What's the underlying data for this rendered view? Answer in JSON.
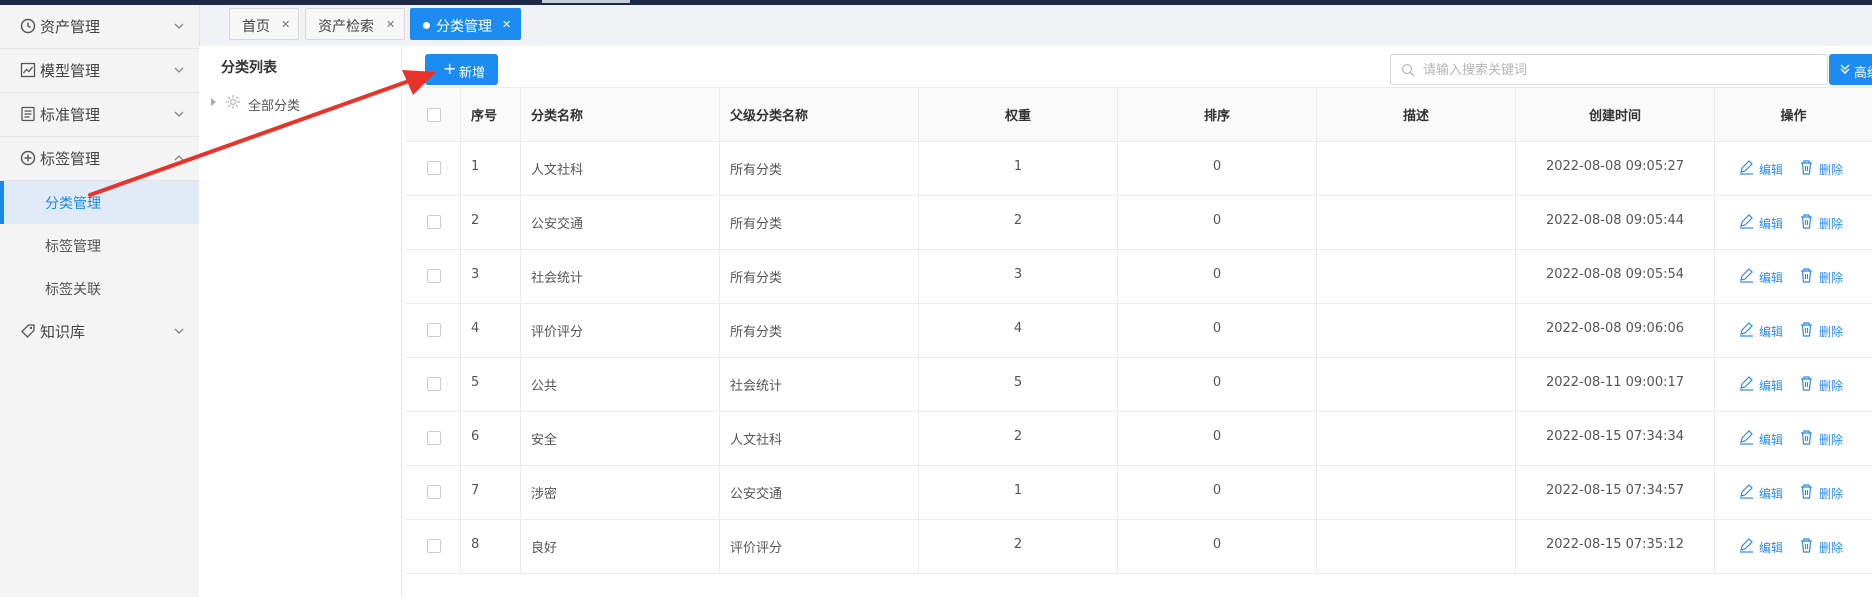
{
  "sidebar": {
    "groups": [
      {
        "label": "资产管理",
        "icon": "clock-icon"
      },
      {
        "label": "模型管理",
        "icon": "chart-icon"
      },
      {
        "label": "标准管理",
        "icon": "document-icon"
      },
      {
        "label": "标签管理",
        "icon": "plus-circle-icon"
      },
      {
        "label": "知识库",
        "icon": "tag-icon"
      }
    ],
    "sub_items": [
      {
        "label": "分类管理",
        "active": true
      },
      {
        "label": "标签管理",
        "active": false
      },
      {
        "label": "标签关联",
        "active": false
      }
    ]
  },
  "tabs": [
    {
      "label": "首页",
      "active": false
    },
    {
      "label": "资产检索",
      "active": false
    },
    {
      "label": "分类管理",
      "active": true
    }
  ],
  "tree": {
    "title": "分类列表",
    "root": "全部分类"
  },
  "toolbar": {
    "add_label": "新增",
    "search_placeholder": "请输入搜索关键词",
    "advanced_label": "高级"
  },
  "table": {
    "headers": [
      "序号",
      "分类名称",
      "父级分类名称",
      "权重",
      "排序",
      "描述",
      "创建时间",
      "操作"
    ],
    "rows": [
      {
        "no": "1",
        "name": "人文社科",
        "parent": "所有分类",
        "weight": "1",
        "order": "0",
        "desc": "",
        "created": "2022-08-08 09:05:27"
      },
      {
        "no": "2",
        "name": "公安交通",
        "parent": "所有分类",
        "weight": "2",
        "order": "0",
        "desc": "",
        "created": "2022-08-08 09:05:44"
      },
      {
        "no": "3",
        "name": "社会统计",
        "parent": "所有分类",
        "weight": "3",
        "order": "0",
        "desc": "",
        "created": "2022-08-08 09:05:54"
      },
      {
        "no": "4",
        "name": "评价评分",
        "parent": "所有分类",
        "weight": "4",
        "order": "0",
        "desc": "",
        "created": "2022-08-08 09:06:06"
      },
      {
        "no": "5",
        "name": "公共",
        "parent": "社会统计",
        "weight": "5",
        "order": "0",
        "desc": "",
        "created": "2022-08-11 09:00:17"
      },
      {
        "no": "6",
        "name": "安全",
        "parent": "人文社科",
        "weight": "2",
        "order": "0",
        "desc": "",
        "created": "2022-08-15 07:34:34"
      },
      {
        "no": "7",
        "name": "涉密",
        "parent": "公安交通",
        "weight": "1",
        "order": "0",
        "desc": "",
        "created": "2022-08-15 07:34:57"
      },
      {
        "no": "8",
        "name": "良好",
        "parent": "评价评分",
        "weight": "2",
        "order": "0",
        "desc": "",
        "created": "2022-08-15 07:35:12"
      }
    ],
    "actions": {
      "edit": "编辑",
      "delete": "删除"
    }
  },
  "colors": {
    "primary": "#1c8cf0",
    "annotation_arrow": "#e8322a",
    "active_menu_bg": "#e1ebf7"
  }
}
